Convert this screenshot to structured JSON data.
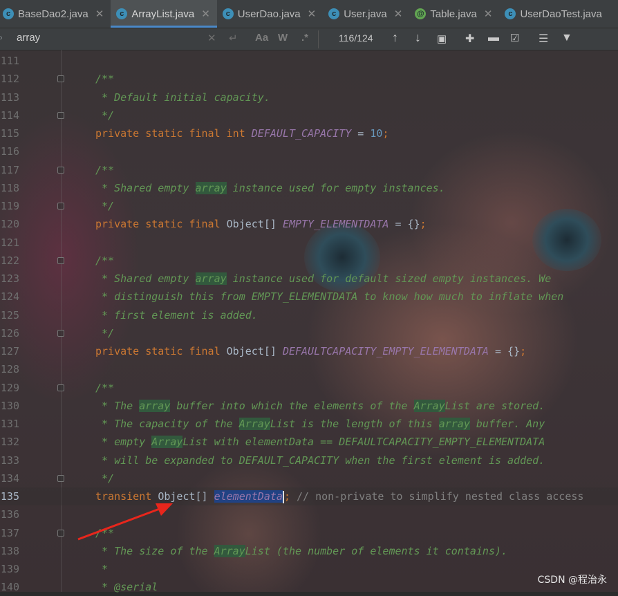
{
  "tabs": [
    {
      "label": "BaseDao2.java",
      "icon": "class-icon",
      "active": false
    },
    {
      "label": "ArrayList.java",
      "icon": "class-icon",
      "active": true
    },
    {
      "label": "UserDao.java",
      "icon": "class-icon",
      "active": false
    },
    {
      "label": "User.java",
      "icon": "class-icon",
      "active": false
    },
    {
      "label": "Table.java",
      "icon": "annotation-icon",
      "active": false
    },
    {
      "label": "UserDaoTest.java",
      "icon": "class-icon",
      "active": false
    }
  ],
  "search": {
    "query": "array",
    "match_case_label": "Aa",
    "words_label": "W",
    "regex_label": ".*",
    "count": "116/124"
  },
  "code_lines": [
    {
      "n": "111",
      "tokens": []
    },
    {
      "n": "112",
      "tokens": [
        {
          "t": "/**",
          "c": "doc"
        }
      ]
    },
    {
      "n": "113",
      "tokens": [
        {
          "t": " * Default initial capacity.",
          "c": "doc"
        }
      ]
    },
    {
      "n": "114",
      "tokens": [
        {
          "t": " */",
          "c": "doc"
        }
      ]
    },
    {
      "n": "115",
      "tokens": [
        {
          "t": "private static final int ",
          "c": "kw"
        },
        {
          "t": "DEFAULT_CAPACITY",
          "c": "field"
        },
        {
          "t": " = ",
          "c": ""
        },
        {
          "t": "10",
          "c": "num"
        },
        {
          "t": ";",
          "c": "kw"
        }
      ]
    },
    {
      "n": "116",
      "tokens": []
    },
    {
      "n": "117",
      "tokens": [
        {
          "t": "/**",
          "c": "doc"
        }
      ]
    },
    {
      "n": "118",
      "tokens": [
        {
          "t": " * Shared empty ",
          "c": "doc"
        },
        {
          "t": "array",
          "c": "doc hl"
        },
        {
          "t": " instance used for empty instances.",
          "c": "doc"
        }
      ]
    },
    {
      "n": "119",
      "tokens": [
        {
          "t": " */",
          "c": "doc"
        }
      ]
    },
    {
      "n": "120",
      "tokens": [
        {
          "t": "private static final ",
          "c": "kw"
        },
        {
          "t": "Object[] ",
          "c": ""
        },
        {
          "t": "EMPTY_ELEMENTDATA",
          "c": "field"
        },
        {
          "t": " = {}",
          "c": ""
        },
        {
          "t": ";",
          "c": "kw"
        }
      ]
    },
    {
      "n": "121",
      "tokens": []
    },
    {
      "n": "122",
      "tokens": [
        {
          "t": "/**",
          "c": "doc"
        }
      ]
    },
    {
      "n": "123",
      "tokens": [
        {
          "t": " * Shared empty ",
          "c": "doc"
        },
        {
          "t": "array",
          "c": "doc hl"
        },
        {
          "t": " instance used for default sized empty instances. We",
          "c": "doc"
        }
      ]
    },
    {
      "n": "124",
      "tokens": [
        {
          "t": " * distinguish this from EMPTY_ELEMENTDATA to know how much to inflate when",
          "c": "doc"
        }
      ]
    },
    {
      "n": "125",
      "tokens": [
        {
          "t": " * first element is added.",
          "c": "doc"
        }
      ]
    },
    {
      "n": "126",
      "tokens": [
        {
          "t": " */",
          "c": "doc"
        }
      ]
    },
    {
      "n": "127",
      "tokens": [
        {
          "t": "private static final ",
          "c": "kw"
        },
        {
          "t": "Object[] ",
          "c": ""
        },
        {
          "t": "DEFAULTCAPACITY_EMPTY_ELEMENTDATA",
          "c": "field"
        },
        {
          "t": " = {}",
          "c": ""
        },
        {
          "t": ";",
          "c": "kw"
        }
      ]
    },
    {
      "n": "128",
      "tokens": []
    },
    {
      "n": "129",
      "tokens": [
        {
          "t": "/**",
          "c": "doc"
        }
      ]
    },
    {
      "n": "130",
      "tokens": [
        {
          "t": " * The ",
          "c": "doc"
        },
        {
          "t": "array",
          "c": "doc hl"
        },
        {
          "t": " buffer into which the elements of the ",
          "c": "doc"
        },
        {
          "t": "Array",
          "c": "doc hl"
        },
        {
          "t": "List are stored.",
          "c": "doc"
        }
      ]
    },
    {
      "n": "131",
      "tokens": [
        {
          "t": " * The capacity of the ",
          "c": "doc"
        },
        {
          "t": "Array",
          "c": "doc hl"
        },
        {
          "t": "List is the length of this ",
          "c": "doc"
        },
        {
          "t": "array",
          "c": "doc hl"
        },
        {
          "t": " buffer. Any",
          "c": "doc"
        }
      ]
    },
    {
      "n": "132",
      "tokens": [
        {
          "t": " * empty ",
          "c": "doc"
        },
        {
          "t": "Array",
          "c": "doc hl"
        },
        {
          "t": "List with elementData == DEFAULTCAPACITY_EMPTY_ELEMENTDATA",
          "c": "doc"
        }
      ]
    },
    {
      "n": "133",
      "tokens": [
        {
          "t": " * will be expanded to DEFAULT_CAPACITY when the first element is added.",
          "c": "doc"
        }
      ]
    },
    {
      "n": "134",
      "tokens": [
        {
          "t": " */",
          "c": "doc"
        }
      ]
    },
    {
      "n": "135",
      "current": true,
      "tokens": [
        {
          "t": "transient ",
          "c": "kw"
        },
        {
          "t": "Object[] ",
          "c": ""
        },
        {
          "t": "elementData",
          "c": "field sel"
        },
        {
          "t": "|",
          "c": "caret"
        },
        {
          "t": "; ",
          "c": "kw"
        },
        {
          "t": "// non-private to simplify nested class access",
          "c": "linecmt"
        }
      ]
    },
    {
      "n": "136",
      "tokens": []
    },
    {
      "n": "137",
      "tokens": [
        {
          "t": "/**",
          "c": "doc"
        }
      ]
    },
    {
      "n": "138",
      "tokens": [
        {
          "t": " * The size of the ",
          "c": "doc"
        },
        {
          "t": "Array",
          "c": "doc hl"
        },
        {
          "t": "List (the number of elements it contains).",
          "c": "doc"
        }
      ]
    },
    {
      "n": "139",
      "tokens": [
        {
          "t": " *",
          "c": "doc"
        }
      ]
    },
    {
      "n": "140",
      "tokens": [
        {
          "t": " * @serial",
          "c": "doc"
        }
      ]
    }
  ],
  "watermark": "CSDN @程治永",
  "colors": {
    "keyword": "#cc7832",
    "field": "#9876aa",
    "number": "#6897bb",
    "doc": "#629755",
    "highlight": "#32593d",
    "selection": "#214283",
    "arrow": "#e8261c"
  }
}
